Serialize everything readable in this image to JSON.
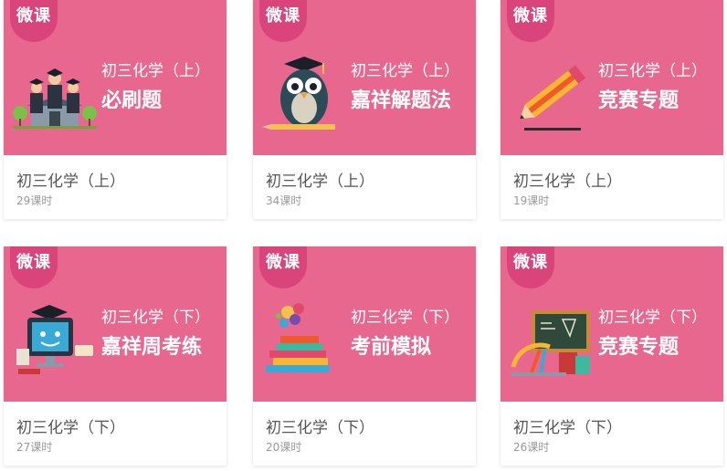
{
  "badge_label": "微课",
  "cards": [
    {
      "banner_subtitle": "初三化学（上）",
      "banner_title": "必刷题",
      "name": "初三化学（上）",
      "lessons": "29课时",
      "icon": "graduates-school-icon"
    },
    {
      "banner_subtitle": "初三化学（上）",
      "banner_title": "嘉祥解题法",
      "name": "初三化学（上）",
      "lessons": "34课时",
      "icon": "owl-pencil-icon"
    },
    {
      "banner_subtitle": "初三化学（上）",
      "banner_title": "竞赛专题",
      "name": "初三化学（上）",
      "lessons": "19课时",
      "icon": "pencil-icon"
    },
    {
      "banner_subtitle": "初三化学（下）",
      "banner_title": "嘉祥周考练",
      "name": "初三化学（下）",
      "lessons": "27课时",
      "icon": "computer-mascot-icon"
    },
    {
      "banner_subtitle": "初三化学（下）",
      "banner_title": "考前模拟",
      "name": "初三化学（下）",
      "lessons": "20课时",
      "icon": "books-splash-icon"
    },
    {
      "banner_subtitle": "初三化学（下）",
      "banner_title": "竞赛专题",
      "name": "初三化学（下）",
      "lessons": "26课时",
      "icon": "blackboard-tools-icon"
    }
  ],
  "colors": {
    "banner": "#e8678f",
    "badge": "#d9457a",
    "text": "#555555",
    "muted": "#999999"
  }
}
